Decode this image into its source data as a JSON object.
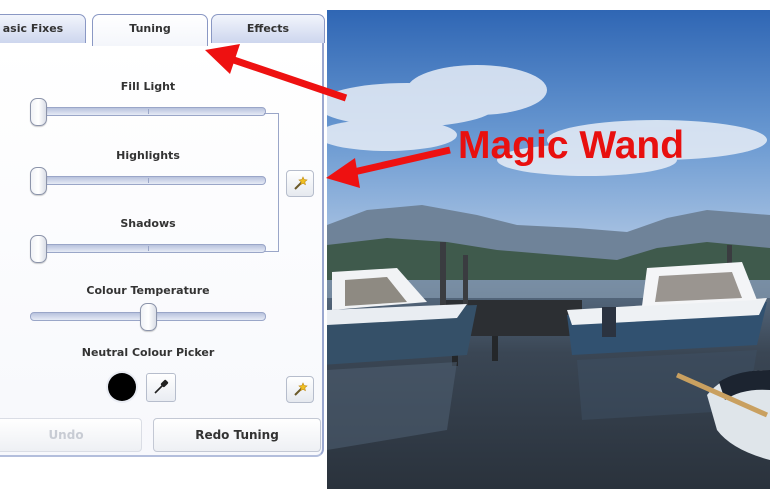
{
  "tabs": [
    {
      "label": "asic Fixes",
      "active": false
    },
    {
      "label": "Tuning",
      "active": true
    },
    {
      "label": "Effects",
      "active": false
    }
  ],
  "sliders": {
    "fill_light": {
      "label": "Fill Light",
      "value": 0.0
    },
    "highlights": {
      "label": "Highlights",
      "value": 0.0
    },
    "shadows": {
      "label": "Shadows",
      "value": 0.0
    },
    "colour_temperature": {
      "label": "Colour Temperature",
      "value": 0.5
    }
  },
  "neutral_picker": {
    "label": "Neutral Colour Picker",
    "swatch_color": "#000000"
  },
  "buttons": {
    "undo": "Undo",
    "redo": "Redo Tuning"
  },
  "annotations": {
    "asterisk": "*",
    "magic_wand": "Magic Wand",
    "color": "#e8100f"
  },
  "icons": {
    "wand": "magic-wand-icon",
    "picker": "eyedropper-icon"
  }
}
